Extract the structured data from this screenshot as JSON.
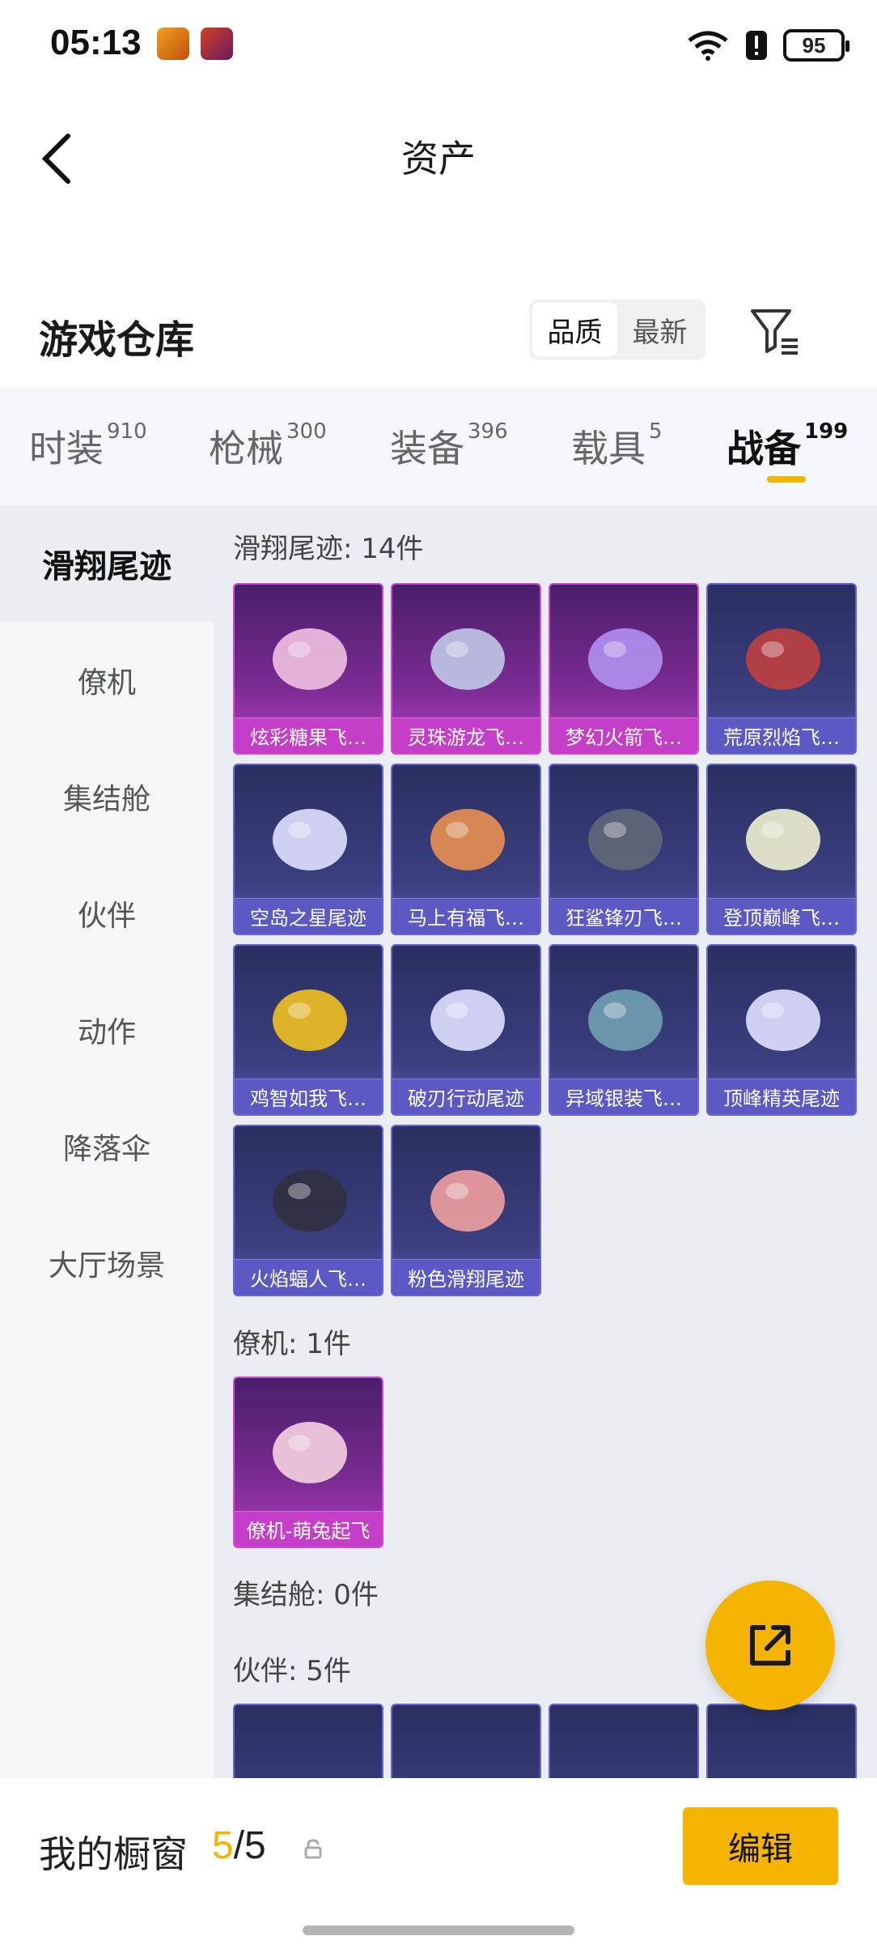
{
  "status_bar": {
    "time": "05:13",
    "battery": "95"
  },
  "header": {
    "title": "资产"
  },
  "warehouse": {
    "title": "游戏仓库",
    "sort_options": [
      "品质",
      "最新"
    ]
  },
  "tabs": [
    {
      "label": "时装",
      "count": "910"
    },
    {
      "label": "枪械",
      "count": "300"
    },
    {
      "label": "装备",
      "count": "396"
    },
    {
      "label": "载具",
      "count": "5"
    },
    {
      "label": "战备",
      "count": "199"
    }
  ],
  "side_nav": [
    "滑翔尾迹",
    "僚机",
    "集结舱",
    "伙伴",
    "动作",
    "降落伞",
    "大厅场景"
  ],
  "groups": {
    "glide": {
      "title": "滑翔尾迹: 14件"
    },
    "wingman": {
      "title": "僚机: 1件"
    },
    "pod": {
      "title": "集结舱: 0件"
    },
    "partner": {
      "title": "伙伴: 5件"
    }
  },
  "items": [
    {
      "name": "炫彩糖果飞…",
      "rarity": "pink"
    },
    {
      "name": "灵珠游龙飞…",
      "rarity": "pink"
    },
    {
      "name": "梦幻火箭飞…",
      "rarity": "pink"
    },
    {
      "name": "荒原烈焰飞…",
      "rarity": "blue"
    },
    {
      "name": "空岛之星尾迹",
      "rarity": "blue"
    },
    {
      "name": "马上有福飞…",
      "rarity": "blue"
    },
    {
      "name": "狂鲨锋刃飞…",
      "rarity": "blue"
    },
    {
      "name": "登顶巅峰飞…",
      "rarity": "blue"
    },
    {
      "name": "鸡智如我飞…",
      "rarity": "blue"
    },
    {
      "name": "破刃行动尾迹",
      "rarity": "blue"
    },
    {
      "name": "异域银装飞…",
      "rarity": "blue"
    },
    {
      "name": "顶峰精英尾迹",
      "rarity": "blue"
    },
    {
      "name": "火焰蝠人飞…",
      "rarity": "blue"
    },
    {
      "name": "粉色滑翔尾迹",
      "rarity": "blue"
    },
    {
      "name": "僚机-萌兔起飞",
      "rarity": "pink"
    }
  ],
  "bottom": {
    "showcase_label": "我的橱窗",
    "current": "5",
    "total": "/5",
    "edit_label": "编辑"
  },
  "colors": {
    "accent": "#f5b400",
    "rare_pink": "#c43ec8",
    "rare_blue": "#5c58c4"
  }
}
